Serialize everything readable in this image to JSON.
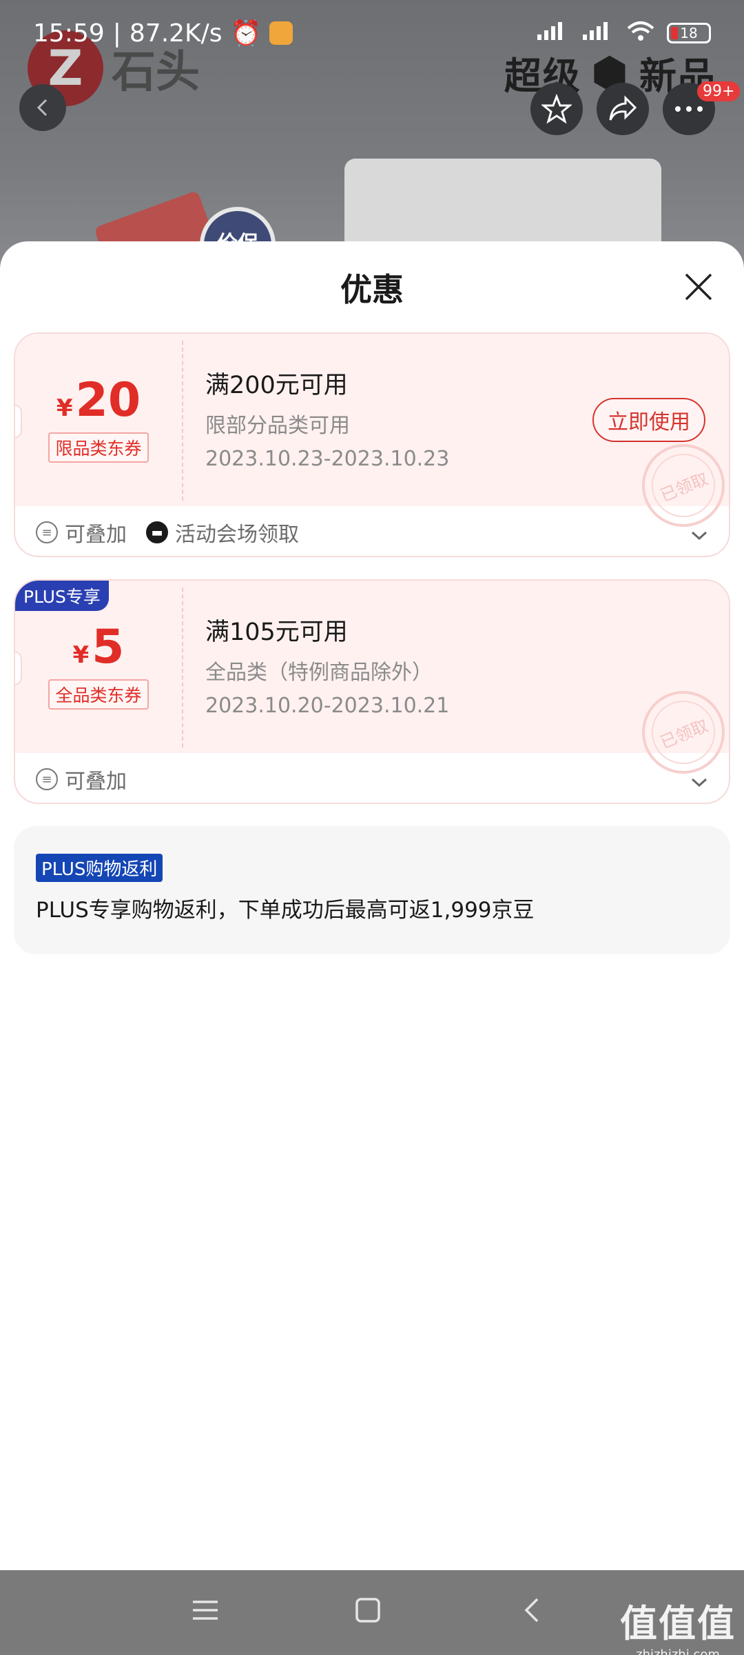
{
  "status": {
    "time": "15:59",
    "speed": "87.2K/s",
    "battery": "18"
  },
  "background": {
    "brand_name": "石头",
    "slogan_left": "超级",
    "slogan_right": "新品",
    "badge_text": "价保",
    "more_badge": "99+"
  },
  "sheet": {
    "title": "优惠"
  },
  "coupons": [
    {
      "currency": "¥",
      "amount": "20",
      "tag": "限品类东券",
      "condition": "满200元可用",
      "scope": "限部分品类可用",
      "date": "2023.10.23-2023.10.23",
      "action": "立即使用",
      "stamp": "已领取",
      "footer_tags": [
        "可叠加",
        "活动会场领取"
      ]
    },
    {
      "plus_tag": "PLUS专享",
      "currency": "¥",
      "amount": "5",
      "tag": "全品类东券",
      "condition": "满105元可用",
      "scope": "全品类（特例商品除外）",
      "date": "2023.10.20-2023.10.21",
      "stamp": "已领取",
      "footer_tags": [
        "可叠加"
      ]
    }
  ],
  "rebate": {
    "tag": "PLUS购物返利",
    "text": "PLUS专享购物返利，下单成功后最高可返1,999京豆"
  },
  "watermark": {
    "big": "值值值",
    "small": "zhizhizhi.com"
  },
  "colors": {
    "accent_red": "#e12d27",
    "plus_blue": "#2a3fb2",
    "coupon_bg": "#fff1f0"
  }
}
